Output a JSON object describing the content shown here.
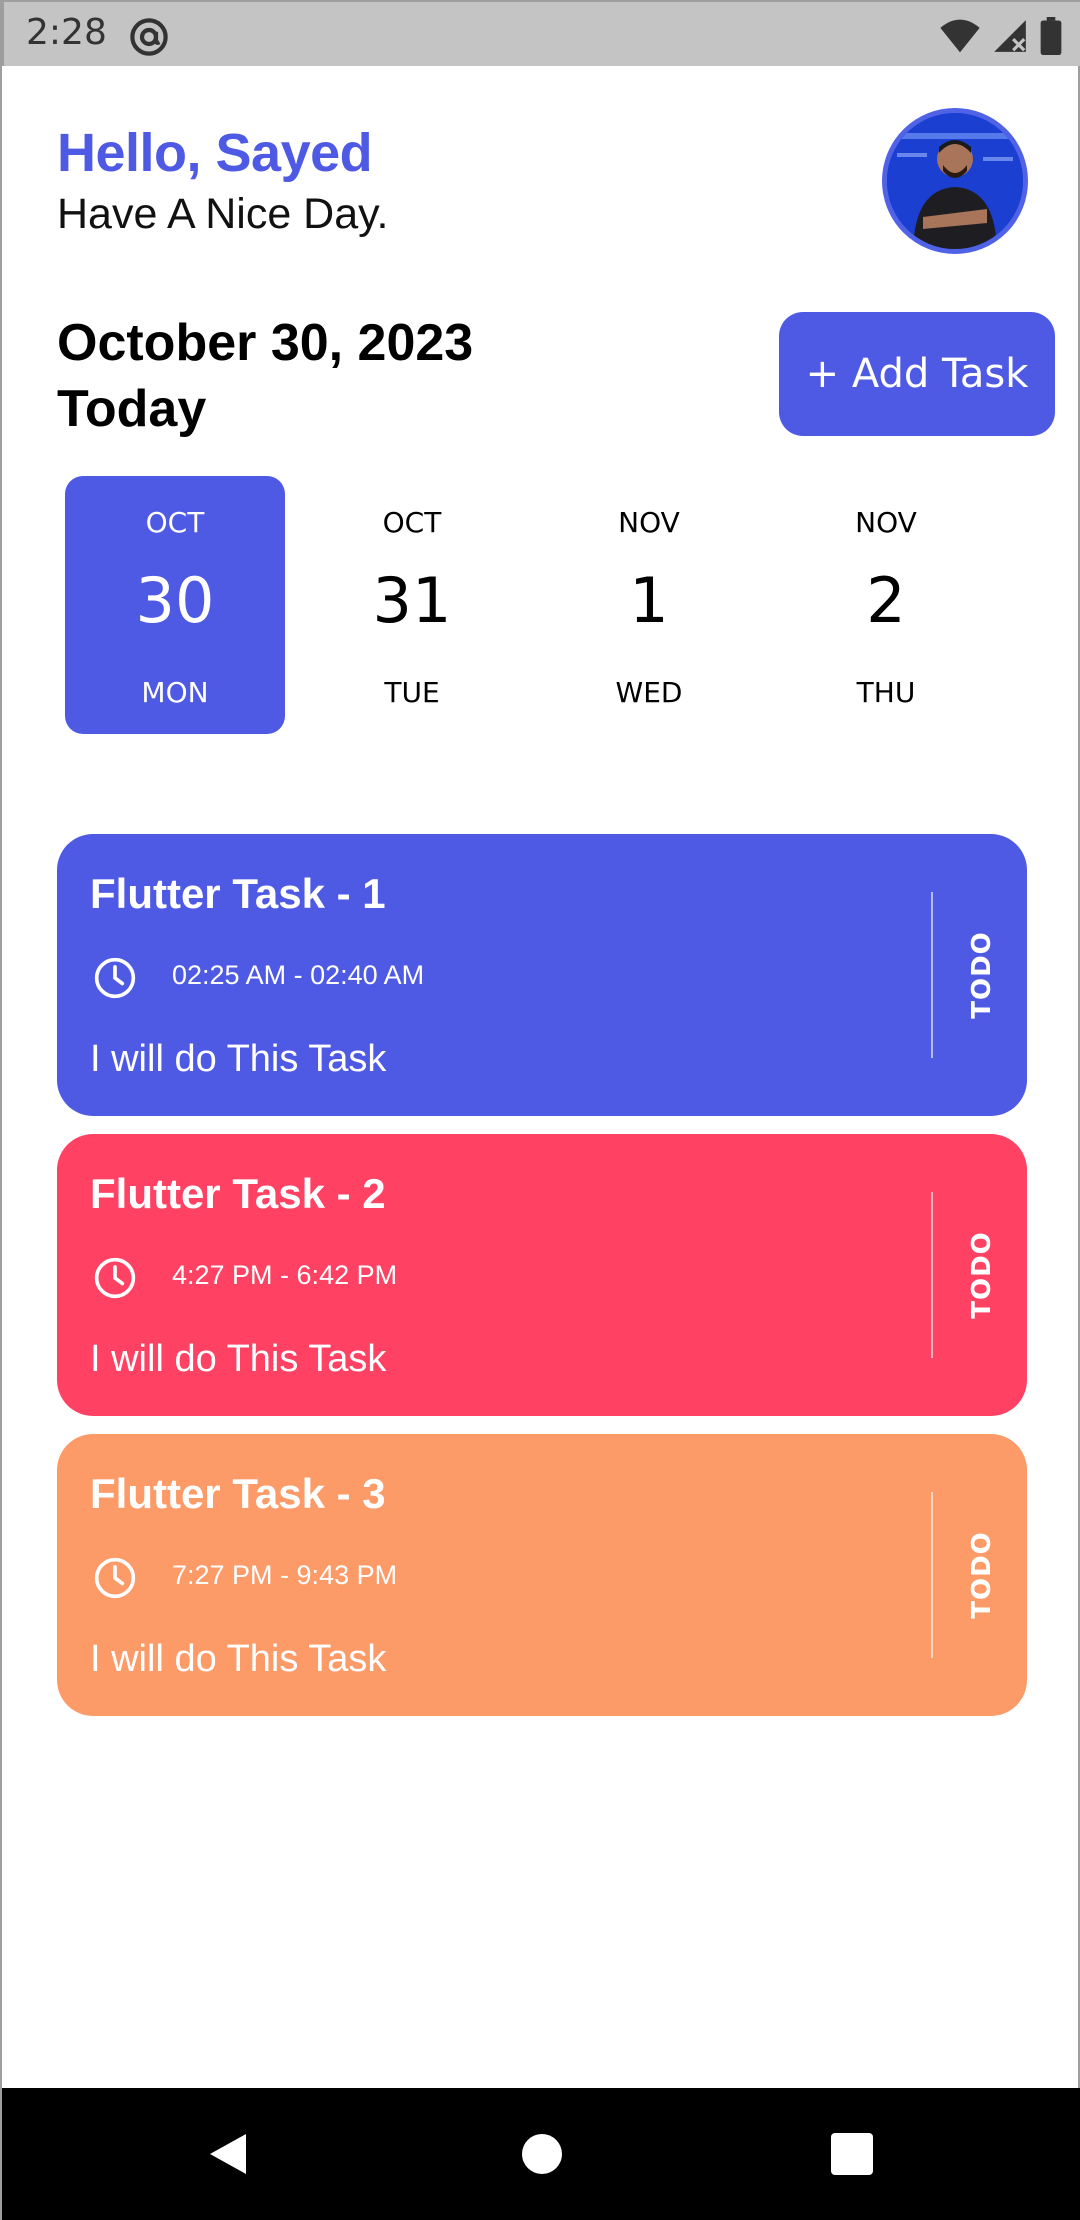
{
  "status_bar": {
    "time": "2:28",
    "icons": [
      "at-sign-icon",
      "wifi-icon",
      "signal-icon",
      "battery-icon"
    ]
  },
  "header": {
    "greeting": "Hello, Sayed",
    "subgreeting": "Have A Nice Day."
  },
  "date_header": {
    "date": "October 30, 2023",
    "label": "Today",
    "add_task_label": "+ Add Task"
  },
  "date_picker": {
    "days": [
      {
        "month": "OCT",
        "day": "30",
        "weekday": "MON",
        "selected": true
      },
      {
        "month": "OCT",
        "day": "31",
        "weekday": "TUE",
        "selected": false
      },
      {
        "month": "NOV",
        "day": "1",
        "weekday": "WED",
        "selected": false
      },
      {
        "month": "NOV",
        "day": "2",
        "weekday": "THU",
        "selected": false
      }
    ]
  },
  "tasks": [
    {
      "title": "Flutter Task - 1",
      "time": "02:25 AM - 02:40 AM",
      "description": "I will do This Task",
      "status": "TODO",
      "color": "#4f5ae4"
    },
    {
      "title": "Flutter Task - 2",
      "time": "4:27 PM - 6:42 PM",
      "description": "I will do This Task",
      "status": "TODO",
      "color": "#ff4264"
    },
    {
      "title": "Flutter Task - 3",
      "time": "7:27 PM - 9:43 PM",
      "description": "I will do This Task",
      "status": "TODO",
      "color": "#fd9b68"
    }
  ],
  "colors": {
    "accent": "#4f5ae4",
    "selected_text": "#ffffff"
  },
  "nav_bar": {
    "buttons": [
      "back-icon",
      "home-icon",
      "recents-icon"
    ]
  }
}
